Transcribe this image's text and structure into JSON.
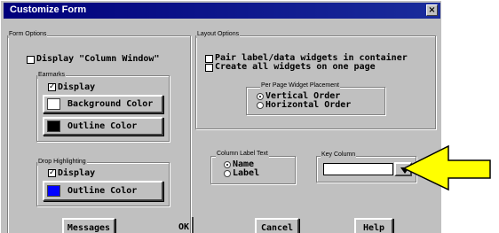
{
  "window": {
    "title": "Customize Form",
    "close_glyph": "×"
  },
  "form_options": {
    "label": "Form Options",
    "display_column_window": "Display \"Column Window\"",
    "earmarks": {
      "label": "Earmarks",
      "display": "Display",
      "background_color": "Background Color",
      "outline_color": "Outline Color",
      "background_swatch": "#ffffff",
      "outline_swatch": "#000000"
    },
    "drop_highlighting": {
      "label": "Drop Highlighting",
      "display": "Display",
      "outline_color": "Outline Color",
      "outline_swatch": "#0000ff"
    }
  },
  "layout_options": {
    "label": "Layout Options",
    "pair_label": "Pair label/data widgets in container",
    "create_all": "Create all widgets on one page",
    "placement": {
      "label": "Per Page Widget Placement",
      "vertical": "Vertical Order",
      "horizontal": "Horizontal Order"
    }
  },
  "column_label_text": {
    "label": "Column Label Text",
    "name": "Name",
    "label_option": "Label"
  },
  "key_column": {
    "label": "Key Column",
    "value": ""
  },
  "buttons": {
    "messages": "Messages",
    "ok": "OK",
    "cancel": "Cancel",
    "help": "Help"
  },
  "annotation": {
    "arrow_color": "#ffff00"
  }
}
